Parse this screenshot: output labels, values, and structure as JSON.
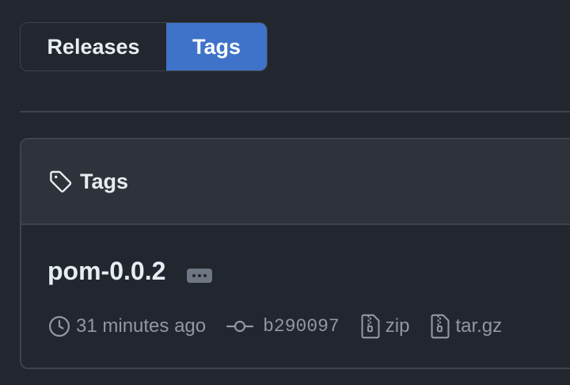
{
  "tabs": {
    "releases_label": "Releases",
    "tags_label": "Tags",
    "selected": "Tags"
  },
  "card": {
    "header_title": "Tags",
    "header_icon": "tag-icon"
  },
  "tag": {
    "name": "pom-0.0.2",
    "time": "31 minutes ago",
    "commit": "b290097",
    "zip_label": "zip",
    "targz_label": "tar.gz"
  },
  "colors": {
    "background": "#22262e",
    "accent": "#3e73c9",
    "border": "#3d444d",
    "muted_text": "#9198a1",
    "header_bg": "#2e323a"
  }
}
